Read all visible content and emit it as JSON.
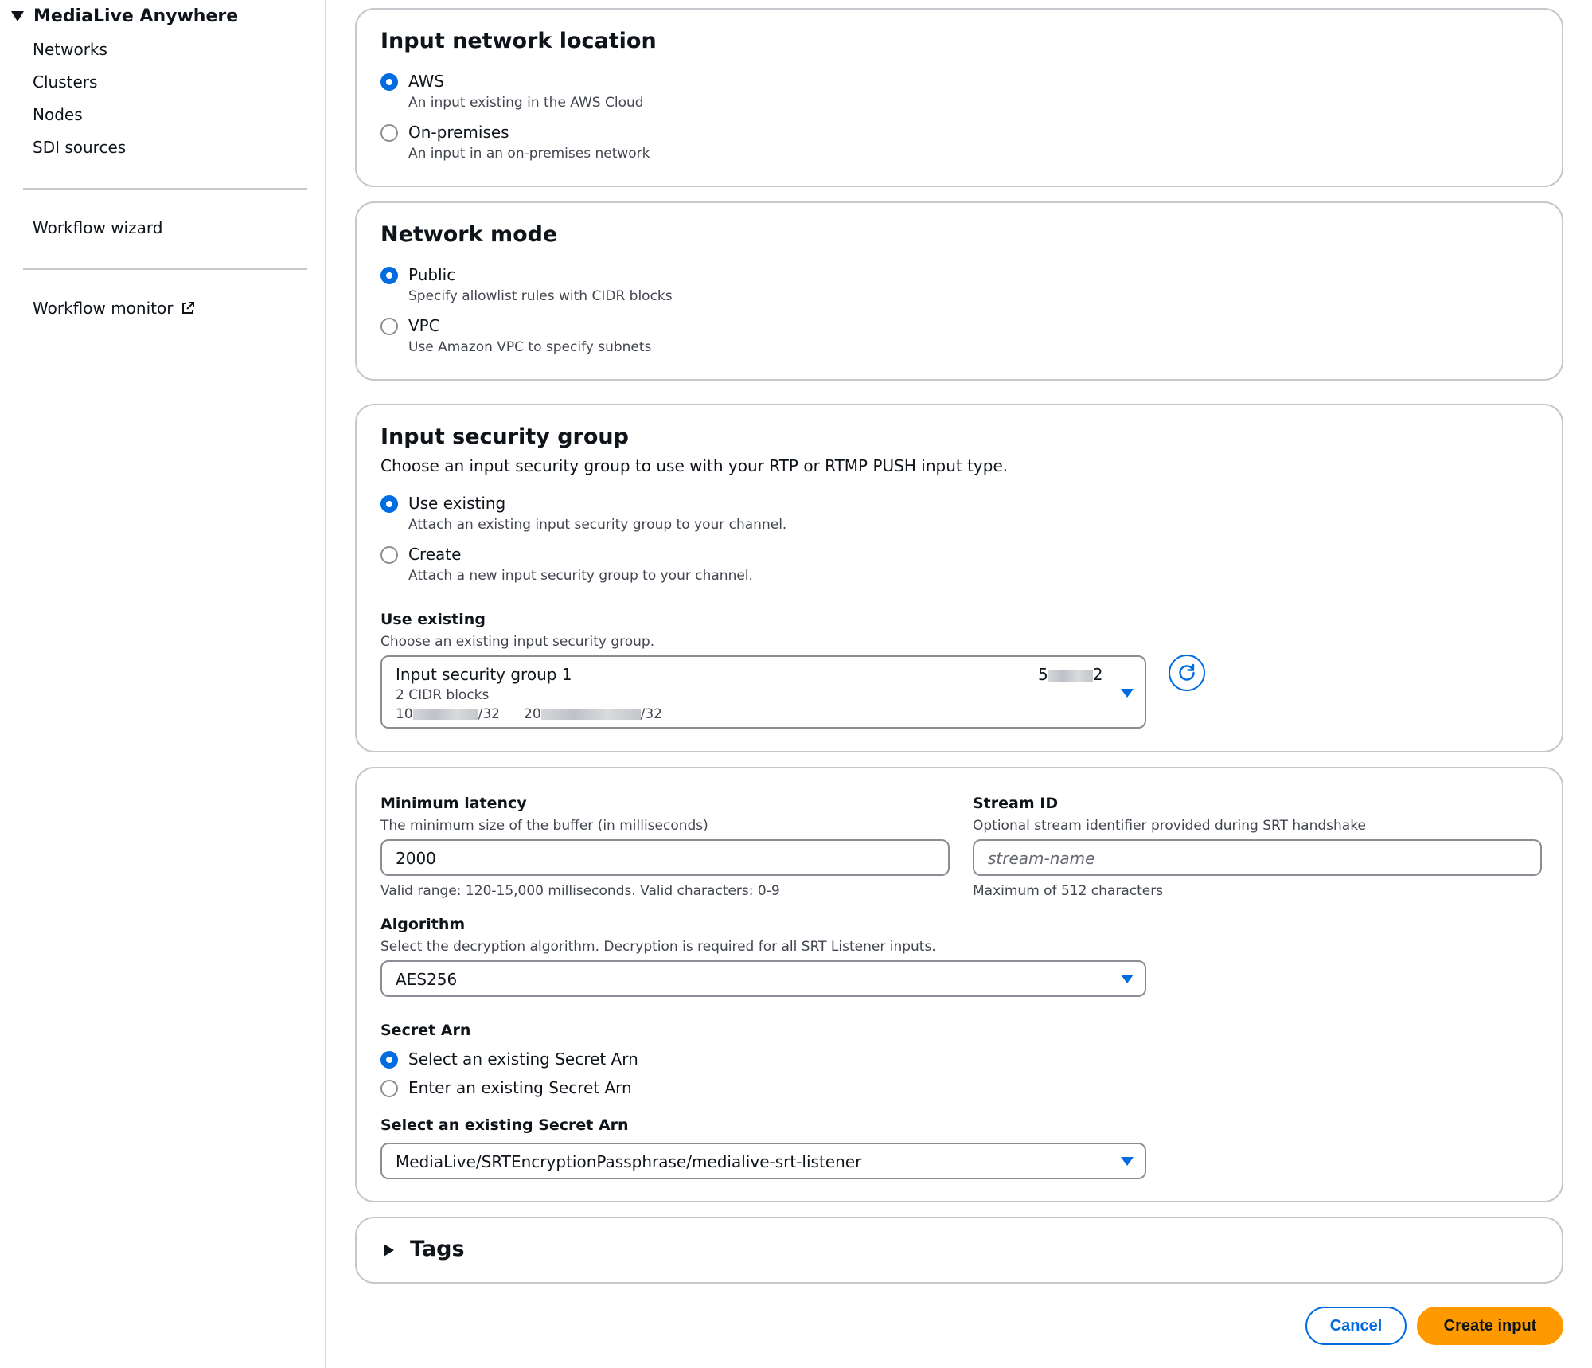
{
  "sidebar": {
    "title": "MediaLive Anywhere",
    "items": [
      "Networks",
      "Clusters",
      "Nodes",
      "SDI sources"
    ],
    "workflow_wizard": "Workflow wizard",
    "workflow_monitor": "Workflow monitor"
  },
  "network_location": {
    "title": "Input network location",
    "options": [
      {
        "label": "AWS",
        "desc": "An input existing in the AWS Cloud",
        "selected": true
      },
      {
        "label": "On-premises",
        "desc": "An input in an on-premises network",
        "selected": false
      }
    ]
  },
  "network_mode": {
    "title": "Network mode",
    "options": [
      {
        "label": "Public",
        "desc": "Specify allowlist rules with CIDR blocks",
        "selected": true
      },
      {
        "label": "VPC",
        "desc": "Use Amazon VPC to specify subnets",
        "selected": false
      }
    ]
  },
  "security_group": {
    "title": "Input security group",
    "subtitle": "Choose an input security group to use with your RTP or RTMP PUSH input type.",
    "options": [
      {
        "label": "Use existing",
        "desc": "Attach an existing input security group to your channel.",
        "selected": true
      },
      {
        "label": "Create",
        "desc": "Attach a new input security group to your channel.",
        "selected": false
      }
    ],
    "use_existing_label": "Use existing",
    "use_existing_desc": "Choose an existing input security group.",
    "selected": {
      "name": "Input security group 1",
      "id_start": "5",
      "id_end": "2",
      "cidr_count": "2 CIDR blocks",
      "cidr1_start": "10",
      "cidr1_end": "/32",
      "cidr2_start": "20",
      "cidr2_end": "/32"
    }
  },
  "srt": {
    "min_latency_label": "Minimum latency",
    "min_latency_desc": "The minimum size of the buffer (in milliseconds)",
    "min_latency_value": "2000",
    "min_latency_hint": "Valid range: 120-15,000 milliseconds. Valid characters: 0-9",
    "stream_id_label": "Stream ID",
    "stream_id_desc": "Optional stream identifier provided during SRT handshake",
    "stream_id_placeholder": "stream-name",
    "stream_id_hint": "Maximum of 512 characters",
    "algorithm_label": "Algorithm",
    "algorithm_desc": "Select the decryption algorithm. Decryption is required for all SRT Listener inputs.",
    "algorithm_value": "AES256",
    "secret_arn_label": "Secret Arn",
    "secret_options": [
      {
        "label": "Select an existing Secret Arn",
        "selected": true
      },
      {
        "label": "Enter an existing Secret Arn",
        "selected": false
      }
    ],
    "select_secret_label": "Select an existing Secret Arn",
    "select_secret_value": "MediaLive/SRTEncryptionPassphrase/medialive-srt-listener"
  },
  "tags": {
    "title": "Tags"
  },
  "actions": {
    "cancel": "Cancel",
    "create": "Create input"
  },
  "colors": {
    "accent": "#006ce0",
    "primary_button": "#ff9900",
    "border": "#c6c6cd"
  }
}
